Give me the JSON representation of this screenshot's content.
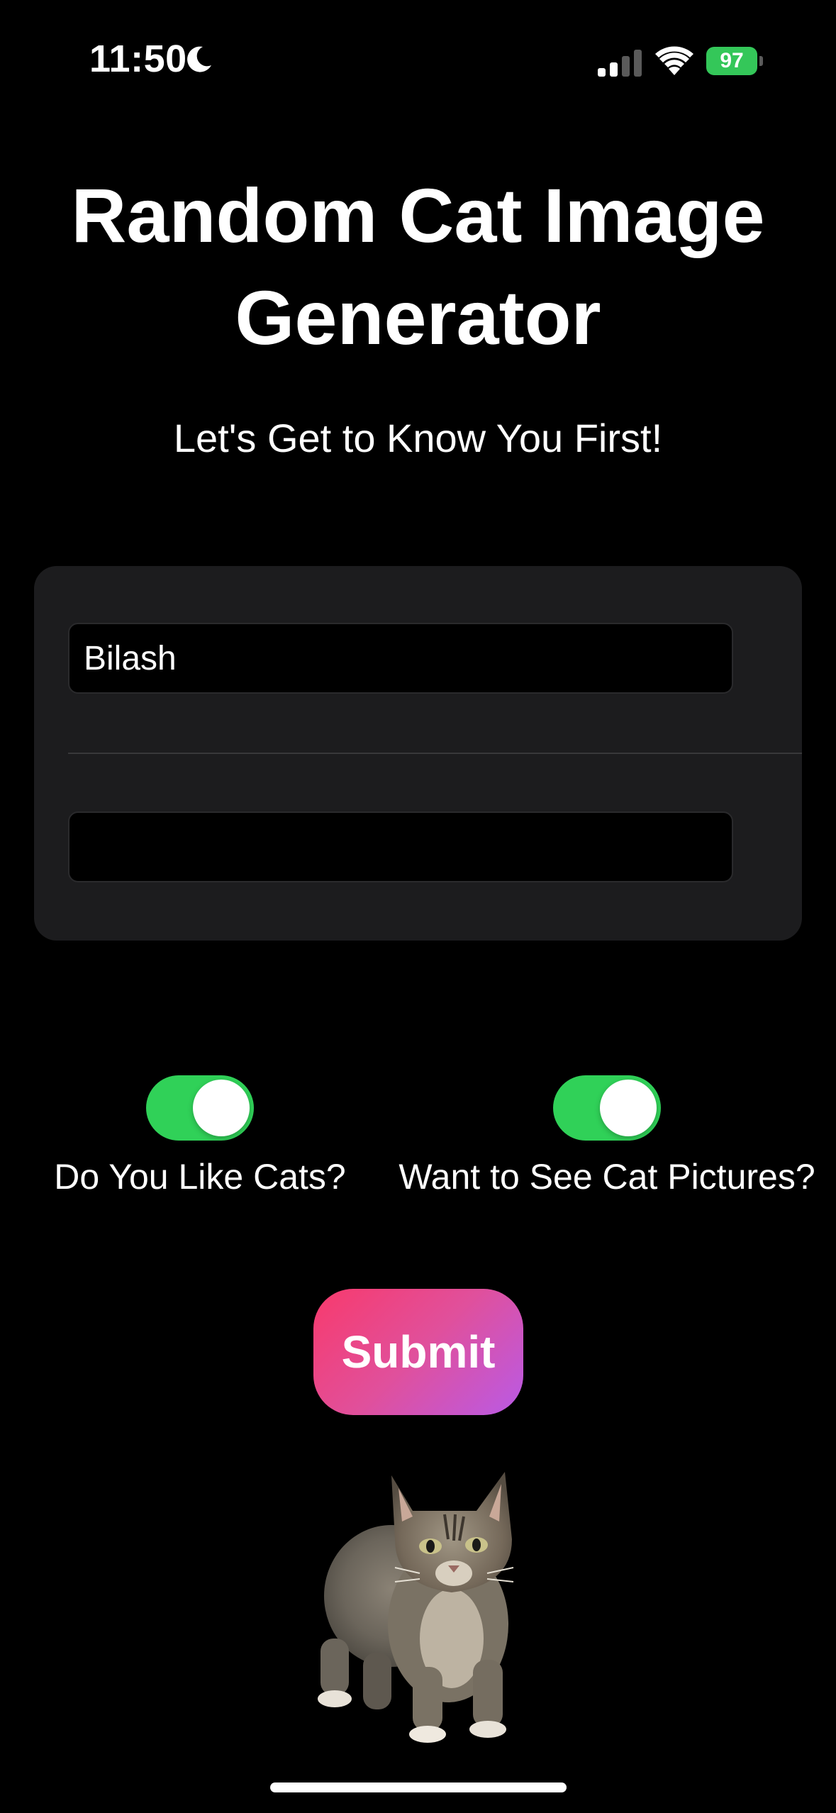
{
  "status_bar": {
    "time": "11:50",
    "battery_level": "97",
    "battery_color": "#34c759"
  },
  "header": {
    "title": "Random Cat Image Generator",
    "subtitle": "Let's Get to Know You First!"
  },
  "form": {
    "name_value": "Bilash",
    "second_value": ""
  },
  "toggles": [
    {
      "label": "Do You Like Cats?",
      "on": true
    },
    {
      "label": "Want to See Cat Pictures?",
      "on": true
    }
  ],
  "submit": {
    "label": "Submit"
  },
  "colors": {
    "background": "#000000",
    "card": "#1c1c1e",
    "toggle_on": "#30d158",
    "submit_gradient_start": "#f83a6c",
    "submit_gradient_end": "#b95ae6"
  },
  "image": {
    "subject": "tabby-cat-photo"
  }
}
